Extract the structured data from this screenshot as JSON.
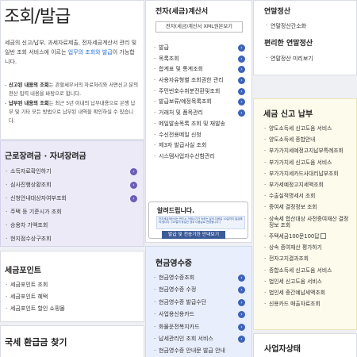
{
  "intro": {
    "title": "조회/발급",
    "lead_pre": "세금의 신고/납부, 과세자료제출, 전자세금계산서 관리 및 일반 조회 서비스에 이르는 ",
    "lead_hl": "업무의 조회와 발급",
    "lead_post": "이 가능합니다.",
    "note1_bold": "신고된 내용의 조회",
    "note1_text": "는 관할세무서의 자료처리와 서면신고 분의 전산 입력 내용을 바탕으로 합니다.",
    "note2_bold": "납부된 내용의 조회",
    "note2_text": "는 최근 5년 이내의 납부내용으로 은행 납부 및 기타 모든 방법으로 납부된 내역을 확인하실 수 있습니다."
  },
  "labor": {
    "title": "근로장려금 · 자녀장려금",
    "items": [
      {
        "label": "소득자료확인하기"
      },
      {
        "label": "심사진행상황조회"
      },
      {
        "label": "신청안내대상자여부조회"
      },
      {
        "label": "주택 등 기준시가 조회"
      },
      {
        "label": "승용차 가액조회"
      },
      {
        "label": "현지점수상구조회"
      }
    ]
  },
  "points": {
    "title": "세금포인트",
    "items": [
      {
        "label": "세금포인트 조회"
      },
      {
        "label": "세금포인트 혜택"
      },
      {
        "label": "세금포인트 할인 쇼핑몰"
      }
    ]
  },
  "refund": {
    "title": "국세 환급금 찾기"
  },
  "einvoice": {
    "title": "전자(세금)계산서",
    "xml_button": "전자(세금)계산서 XML원본보기",
    "items": [
      {
        "label": "발급"
      },
      {
        "label": "목록조회"
      },
      {
        "label": "합계표 및 통계조회"
      },
      {
        "label": "사용자유형별 조회권한 관리"
      },
      {
        "label": "주민번호수취분전환및조회"
      },
      {
        "label": "발급보류/예정목록조회"
      },
      {
        "label": "거래처 및 품목관리"
      },
      {
        "label": "메일발송목록 조회 및 재발송"
      },
      {
        "label": "수신전용메일 신청"
      },
      {
        "label": "제3자 발급사실 조회"
      },
      {
        "label": "시스템사업자수신함관리"
      }
    ]
  },
  "alert": {
    "title": "알려드립니다.",
    "text": "전자세금계산서는 반드시 거래시기가 속하는 달의 다음달 10일까지 발급해야 합니다. (10일이 휴일인 경우 다음날로 연장됩니다.)",
    "button": "발급 및 전송기한 안내보기"
  },
  "cash": {
    "title": "현금영수증",
    "items": [
      {
        "label": "현금영수증조회"
      },
      {
        "label": "현금영수증 수정"
      },
      {
        "label": "현금영수증 발급수단"
      },
      {
        "label": "사업용신용카드"
      },
      {
        "label": "화물운전복지카드"
      },
      {
        "label": "납세관리인 조회 서비스"
      },
      {
        "label": "현금영수증 안내문 발급 안내"
      }
    ]
  },
  "yearend": {
    "title": "연말정산",
    "item1": "연말정산간소화",
    "title2": "편리한 연말정산",
    "item2": "연말정산 미리보기"
  },
  "report": {
    "title": "세금 신고 납부",
    "items": [
      {
        "label": "양도소득세 신고도움 서비스"
      },
      {
        "label": "양도소득세 종합안내"
      },
      {
        "label": "부가가치세예정고지납부특례조회"
      },
      {
        "label": "부가가치세 신고도움 서비스"
      },
      {
        "label": "부가가치세카드사대리납부조회"
      },
      {
        "label": "부가세예정고지세액조회"
      },
      {
        "label": "수출실적명세서 조회"
      },
      {
        "label": "증여세 결정정보 조회"
      },
      {
        "label": "상속세 합산대상 사전증여재산 결정정보 조회"
      },
      {
        "label": "주택세금100문100답",
        "ext": true
      },
      {
        "label": "상속 증여재산 평가하기"
      },
      {
        "label": "전자고지결과조회"
      },
      {
        "label": "종합소득세 신고도움 서비스"
      },
      {
        "label": "법인세 신고도움 서비스"
      },
      {
        "label": "법인세 중간예납세액조회"
      },
      {
        "label": "신용카드 매출자료조회"
      }
    ]
  },
  "biz": {
    "title": "사업자상태"
  }
}
